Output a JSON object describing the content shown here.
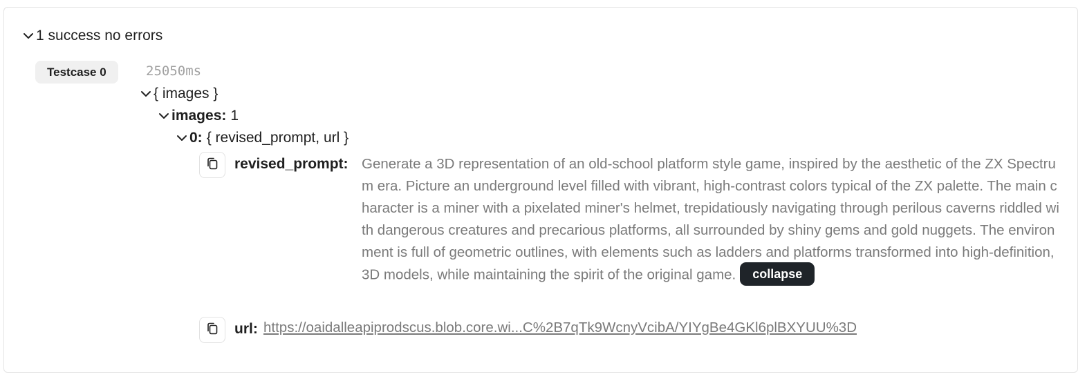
{
  "summary": {
    "label": "1 success no errors"
  },
  "testcase": {
    "label": "Testcase 0",
    "duration": "25050ms"
  },
  "tree": {
    "root_label": "{ images }",
    "images_key": "images:",
    "images_count": "1",
    "item_key": "0:",
    "item_fields": "{ revised_prompt, url }",
    "revised_prompt_key": "revised_prompt:",
    "revised_prompt_value": "Generate a 3D representation of an old-school platform style game, inspired by the aesthetic of the ZX Spectrum era. Picture an underground level filled with vibrant, high-contrast colors typical of the ZX palette. The main character is a miner with a pixelated miner's helmet, trepidatiously navigating through perilous caverns riddled with dangerous creatures and precarious platforms, all surrounded by shiny gems and gold nuggets. The environment is full of geometric outlines, with elements such as ladders and platforms transformed into high-definition, 3D models, while maintaining the spirit of the original game.",
    "collapse_label": "collapse",
    "url_key": "url:",
    "url_value": "https://oaidalleapiprodscus.blob.core.wi...C%2B7qTk9WcnyVcibA/YIYgBe4GKl6plBXYUU%3D"
  },
  "icons": {
    "expand": "chevron-down-icon",
    "copy": "copy-icon"
  }
}
